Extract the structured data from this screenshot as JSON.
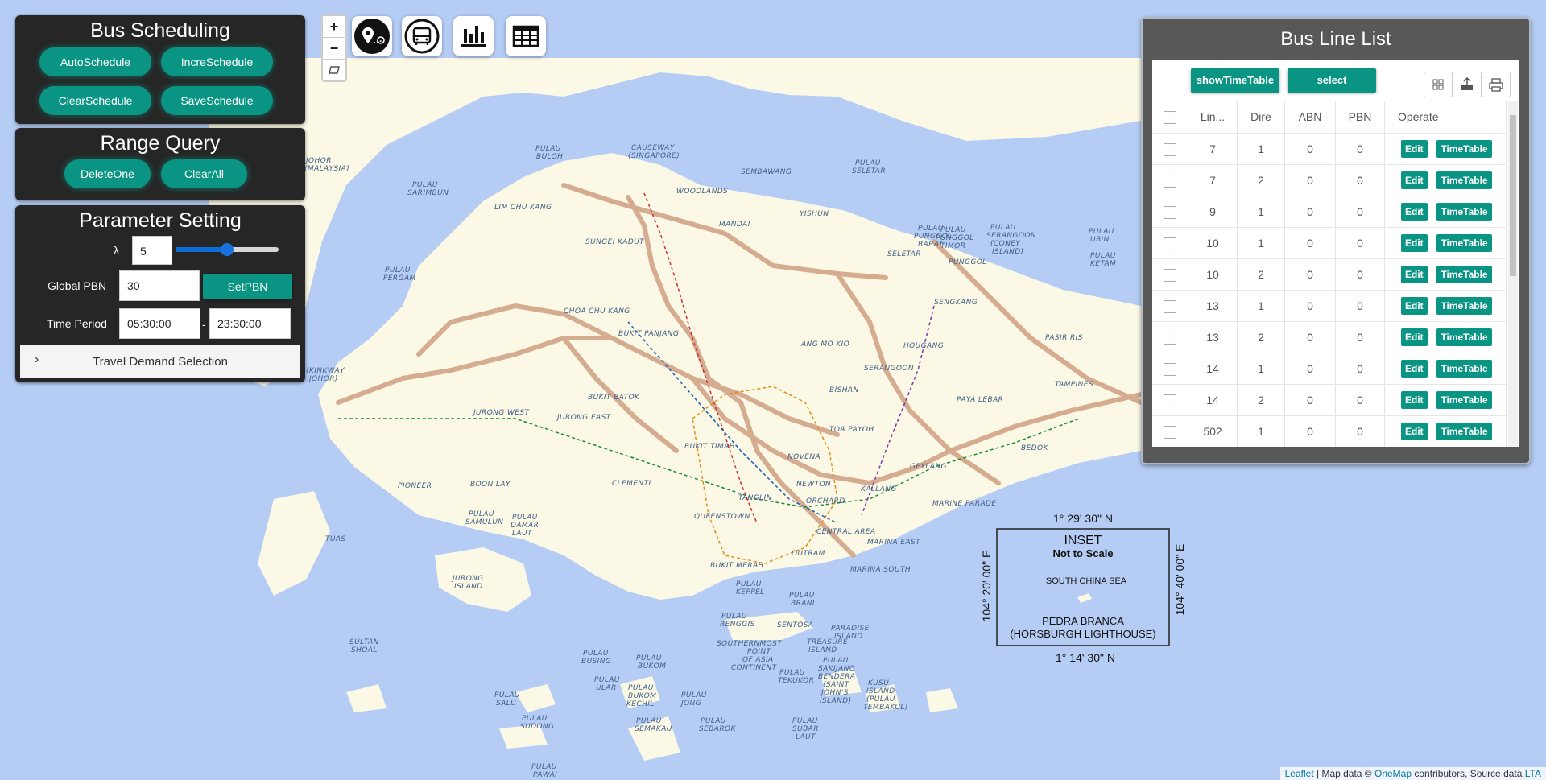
{
  "bus_scheduling": {
    "title": "Bus Scheduling",
    "buttons": [
      "AutoSchedule",
      "IncreSchedule",
      "ClearSchedule",
      "SaveSchedule"
    ]
  },
  "range_query": {
    "title": "Range Query",
    "buttons": [
      "DeleteOne",
      "ClearAll"
    ]
  },
  "parameter_setting": {
    "title": "Parameter Setting",
    "lambda_label": "λ",
    "lambda_value": "5",
    "lambda_slider_fraction": 0.5,
    "global_pbn_label": "Global PBN",
    "global_pbn_value": "30",
    "set_pbn_label": "SetPBN",
    "time_period_label": "Time Period",
    "time_start": "05:30:00",
    "time_separator": "-",
    "time_end": "23:30:00",
    "travel_demand_label": "Travel Demand Selection",
    "travel_demand_chevron": "›"
  },
  "map_controls": {
    "zoom_in": "+",
    "zoom_out": "−",
    "toolbar_icons": [
      "location-pin-icon",
      "bus-icon",
      "bar-chart-icon",
      "table-icon"
    ]
  },
  "map_labels": [
    "JOHOR (MALAYSIA)",
    "PULAU SARIMBUN",
    "PULAU BULOH",
    "CAUSEWAY (SINGAPORE)",
    "LIM CHU KANG",
    "WOODLANDS",
    "SEMBAWANG",
    "MANDAI",
    "YISHUN",
    "SUNGEI KADUT",
    "PULAU SELETAR",
    "PULAU PUNGGOL BARAT",
    "PULAU PUNGGOL TIMOR",
    "PULAU SERANGOON (CONEY ISLAND)",
    "PULAU UBIN",
    "PULAU KETAM",
    "SELETAR",
    "PUNGGOL",
    "SENGKANG",
    "PULAU PERGAM",
    "CHOA CHU KANG",
    "BUKIT PANJANG",
    "ANG MO KIO",
    "HOUGANG",
    "PASIR RIS",
    "SERANGOON",
    "TAMPINES",
    "BISHAN",
    "PAYA LEBAR",
    "BUKIT BATOK",
    "JURONG WEST",
    "JURONG EAST",
    "TOA PAYOH",
    "BUKIT TIMAH",
    "NOVENA",
    "GEYLANG",
    "BEDOK",
    "PIONEER",
    "BOON LAY",
    "CLEMENTI",
    "NEWTON",
    "KALLANG",
    "TANGLIN",
    "ORCHARD",
    "MARINE PARADE",
    "QUEENSTOWN",
    "CENTRAL AREA",
    "MARINA EAST",
    "PULAU SAMULUN",
    "PULAU DAMAR LAUT",
    "TUAS",
    "JURONG ISLAND",
    "BUKIT MERAH",
    "OUTRAM",
    "MARINA SOUTH",
    "PULAU KEPPEL",
    "PULAU BRANI",
    "PULAU RENGGIS",
    "SENTOSA",
    "PARADISE ISLAND",
    "TREASURE ISLAND",
    "SULTAN SHOAL",
    "SOUTHERNMOST POINT OF ASIA CONTINENT",
    "PULAU BUSING",
    "PULAU BUKOM",
    "PULAU ULAR",
    "PULAU BUKOM KECHIL",
    "PULAU SAKIJANG BENDERA (SAINT JOHN'S ISLAND)",
    "PULAU TEKUKOR",
    "KUSU ISLAND (PULAU TEMBAKUL)",
    "PULAU SALU",
    "PULAU JONG",
    "PULAU SUDONG",
    "PULAU SEMAKAU",
    "PULAU SEBAROK",
    "PULAU SUBAR LAUT",
    "PULAU PAWAI",
    "(KINKWAY JOHOR)"
  ],
  "inset": {
    "title": "INSET",
    "subtitle": "Not to Scale",
    "sea": "SOUTH CHINA SEA",
    "place_line1": "PEDRA BRANCA",
    "place_line2": "(HORSBURGH LIGHTHOUSE)",
    "lat_top": "1° 29' 30\" N",
    "lat_bottom": "1° 14' 30\" N",
    "lon_left": "104° 20' 00\" E",
    "lon_right": "104° 40' 00\" E"
  },
  "bus_line_list": {
    "title": "Bus Line List",
    "show_timetable_label": "showTimeTable",
    "select_label": "select",
    "tool_icons": [
      "columns-icon",
      "export-icon",
      "print-icon"
    ],
    "columns": [
      "Lin...",
      "Dire",
      "ABN",
      "PBN",
      "Operate"
    ],
    "edit_label": "Edit",
    "timetable_label": "TimeTable",
    "rows": [
      {
        "line": "7",
        "dir": "1",
        "abn": "0",
        "pbn": "0"
      },
      {
        "line": "7",
        "dir": "2",
        "abn": "0",
        "pbn": "0"
      },
      {
        "line": "9",
        "dir": "1",
        "abn": "0",
        "pbn": "0"
      },
      {
        "line": "10",
        "dir": "1",
        "abn": "0",
        "pbn": "0"
      },
      {
        "line": "10",
        "dir": "2",
        "abn": "0",
        "pbn": "0"
      },
      {
        "line": "13",
        "dir": "1",
        "abn": "0",
        "pbn": "0"
      },
      {
        "line": "13",
        "dir": "2",
        "abn": "0",
        "pbn": "0"
      },
      {
        "line": "14",
        "dir": "1",
        "abn": "0",
        "pbn": "0"
      },
      {
        "line": "14",
        "dir": "2",
        "abn": "0",
        "pbn": "0"
      },
      {
        "line": "502",
        "dir": "1",
        "abn": "0",
        "pbn": "0"
      }
    ]
  },
  "attribution": {
    "leaflet": "Leaflet",
    "sep": " | Map data © ",
    "onemap": "OneMap",
    "mid": " contributors, Source data ",
    "lta": "LTA"
  },
  "colors": {
    "teal": "#0a9483",
    "panel_dark": "#262626",
    "sea": "#b5cdf5",
    "land": "#fbf8e5",
    "expressway": "#d4a88c"
  }
}
